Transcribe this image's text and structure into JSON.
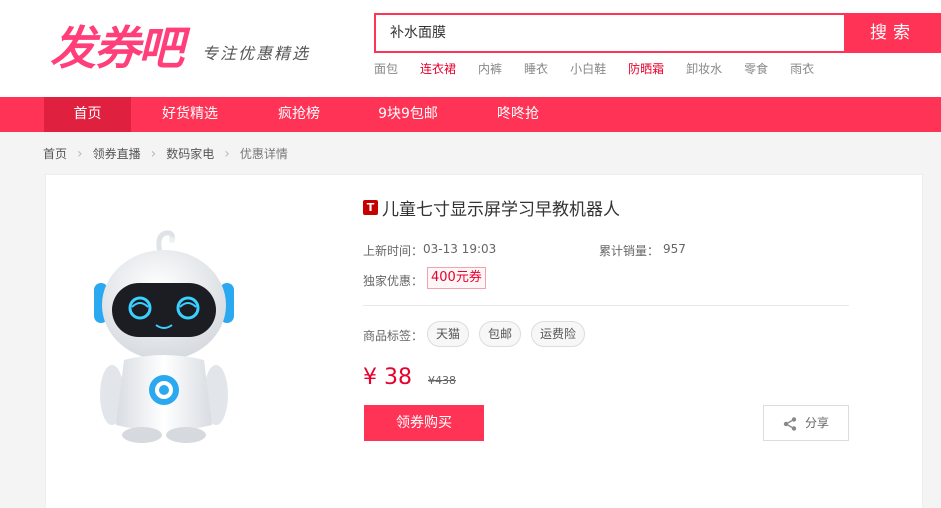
{
  "logo": {
    "main": "发券吧",
    "sub": "专注优惠精选"
  },
  "search": {
    "value": "补水面膜",
    "button_label": "搜索"
  },
  "hot_words": [
    {
      "label": "面包",
      "highlight": false
    },
    {
      "label": "连衣裙",
      "highlight": true
    },
    {
      "label": "内裤",
      "highlight": false
    },
    {
      "label": "睡衣",
      "highlight": false
    },
    {
      "label": "小白鞋",
      "highlight": false
    },
    {
      "label": "防晒霜",
      "highlight": true
    },
    {
      "label": "卸妆水",
      "highlight": false
    },
    {
      "label": "零食",
      "highlight": false
    },
    {
      "label": "雨衣",
      "highlight": false
    }
  ],
  "nav": [
    {
      "label": "首页",
      "active": true
    },
    {
      "label": "好货精选",
      "active": false
    },
    {
      "label": "疯抢榜",
      "active": false
    },
    {
      "label": "9块9包邮",
      "active": false
    },
    {
      "label": "咚咚抢",
      "active": false
    }
  ],
  "breadcrumb": [
    "首页",
    "领券直播",
    "数码家电",
    "优惠详情"
  ],
  "product": {
    "badge": "T",
    "title": "儿童七寸显示屏学习早教机器人",
    "update_label": "上新时间：",
    "update_time": "03-13 19:03",
    "sales_label": "累计销量：",
    "sales_value": "957",
    "coupon_label": "独家优惠：",
    "coupon_value": "400元券",
    "tags_label": "商品标签：",
    "tags": [
      "天猫",
      "包邮",
      "运费险"
    ],
    "price": "¥ 38",
    "old_price": "¥438",
    "buy_label": "领券购买",
    "share_label": "分享"
  },
  "colors": {
    "brand": "#ff3355",
    "logo": "#ff3e7a",
    "price": "#e8002d"
  }
}
